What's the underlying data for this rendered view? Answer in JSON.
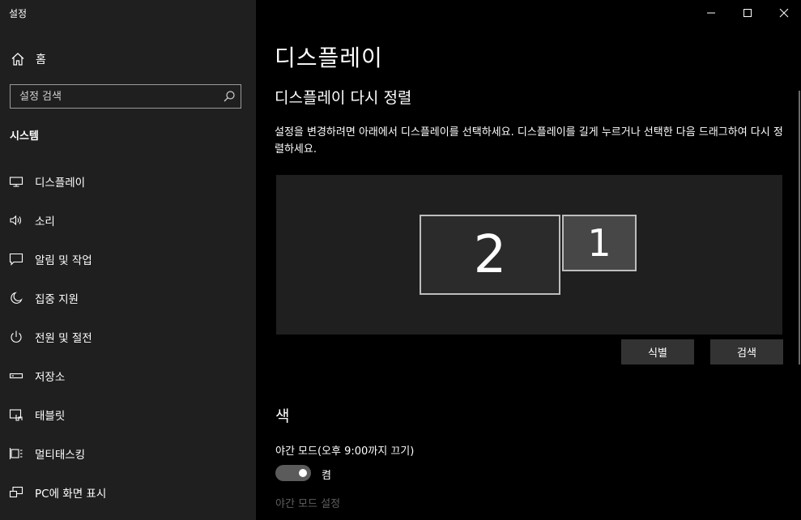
{
  "window": {
    "title": "설정",
    "minimize_icon": "minimize-icon",
    "maximize_icon": "maximize-icon",
    "close_icon": "close-icon"
  },
  "sidebar": {
    "home_label": "홈",
    "search_placeholder": "설정 검색",
    "section_label": "시스템",
    "items": [
      {
        "label": "디스플레이",
        "icon": "display-icon"
      },
      {
        "label": "소리",
        "icon": "speaker-icon"
      },
      {
        "label": "알림 및 작업",
        "icon": "notification-icon"
      },
      {
        "label": "집중 지원",
        "icon": "moon-icon"
      },
      {
        "label": "전원 및 절전",
        "icon": "power-icon"
      },
      {
        "label": "저장소",
        "icon": "storage-icon"
      },
      {
        "label": "태블릿",
        "icon": "tablet-icon"
      },
      {
        "label": "멀티태스킹",
        "icon": "multitasking-icon"
      },
      {
        "label": "PC에 화면 표시",
        "icon": "project-icon"
      }
    ]
  },
  "main": {
    "page_title": "디스플레이",
    "section_title": "디스플레이 다시 정렬",
    "description": "설정을 변경하려면 아래에서 디스플레이를 선택하세요. 디스플레이를 길게 누르거나 선택한 다음 드래그하여 다시 정렬하세요.",
    "monitors": [
      {
        "number": "2"
      },
      {
        "number": "1"
      }
    ],
    "identify_label": "식별",
    "detect_label": "검색",
    "color_heading": "색",
    "night_light_label": "야간 모드(오후 9:00까지 끄기)",
    "night_light_state": "켬",
    "night_light_settings": "야간 모드 설정"
  },
  "colors": {
    "sidebar_bg": "#1f1f1f",
    "main_bg": "#000000",
    "button_bg": "#333333",
    "toggle_bg": "#5b5b5b"
  }
}
